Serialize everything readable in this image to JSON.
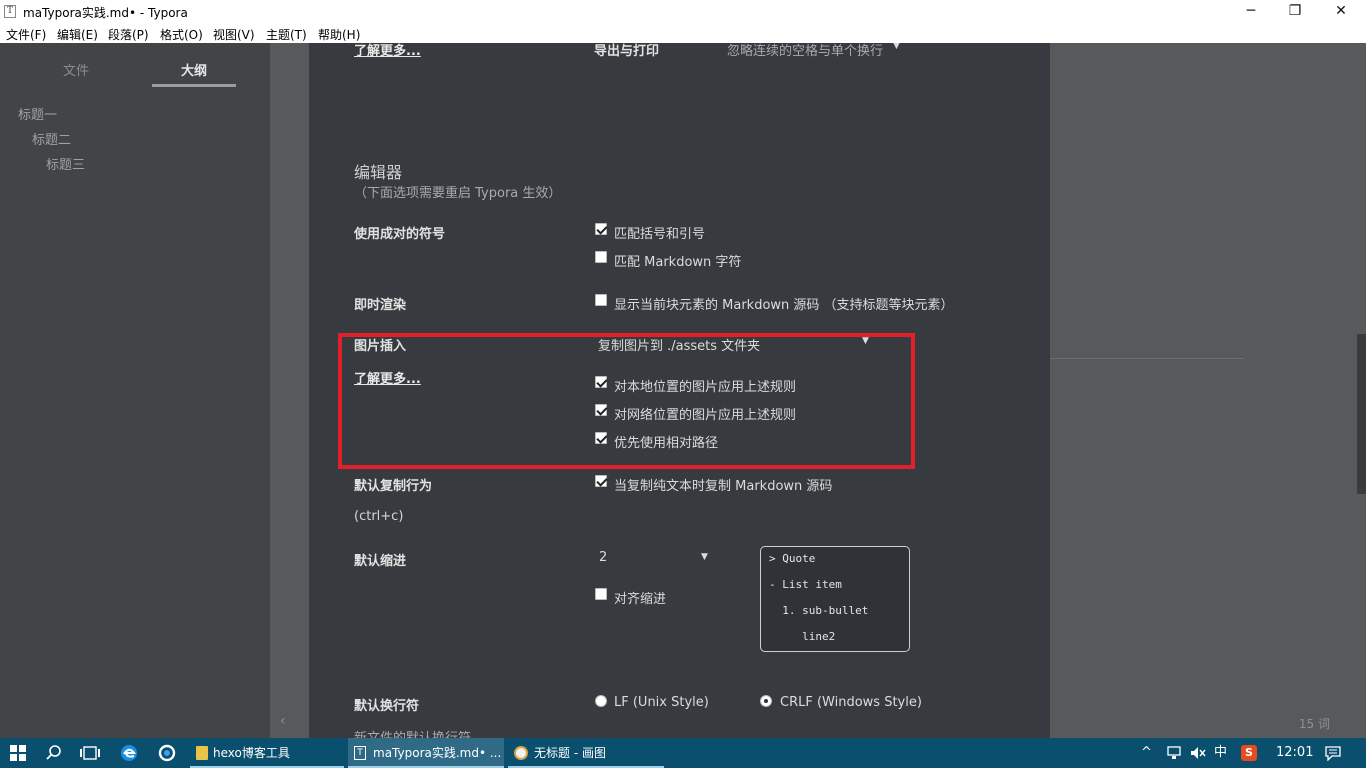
{
  "window": {
    "title": "maTypora实践.md• - Typora",
    "app_icon": "T",
    "minimize_icon": "─",
    "maximize_icon": "❐",
    "close_icon": "✕"
  },
  "menu": [
    "文件(F)",
    "编辑(E)",
    "段落(P)",
    "格式(O)",
    "视图(V)",
    "主题(T)",
    "帮助(H)"
  ],
  "sidebar": {
    "tabs": [
      "文件",
      "大纲"
    ],
    "active_tab": "大纲",
    "outline": [
      "标题一",
      "标题二",
      "标题三"
    ]
  },
  "prefs": {
    "top_link": "了解更多...",
    "export_label": "导出与打印",
    "export_value": "忽略连续的空格与单个换行",
    "editor_title": "编辑器",
    "editor_note": "（下面选项需要重启 Typora 生效）",
    "pairs_label": "使用成对的符号",
    "pairs_opt1": "匹配括号和引号",
    "pairs_opt2": "匹配 Markdown 字符",
    "render_label": "即时渲染",
    "render_opt": "显示当前块元素的 Markdown 源码 （支持标题等块元素）",
    "image_label": "图片插入",
    "image_link": "了解更多...",
    "image_value": "复制图片到 ./assets 文件夹",
    "image_opt1": "对本地位置的图片应用上述规则",
    "image_opt2": "对网络位置的图片应用上述规则",
    "image_opt3": "优先使用相对路径",
    "copy_label": "默认复制行为",
    "copy_shortcut": "(ctrl+c)",
    "copy_opt": "当复制纯文本时复制 Markdown 源码",
    "indent_label": "默认缩进",
    "indent_value": "2",
    "indent_opt": "对齐缩进",
    "preview_lines": [
      "> Quote",
      "- List item",
      "  1. sub-bullet",
      "     line2"
    ],
    "newline_label": "默认换行符",
    "newline_opt1": "LF (Unix Style)",
    "newline_opt2": "CRLF (Windows Style)",
    "newline_sub": "新文件的默认换行符"
  },
  "status": {
    "word_count": "15 词",
    "collapse_icon": "‹"
  },
  "taskbar": {
    "apps": [
      "hexo博客工具",
      "maTypora实践.md• ...",
      "无标题 - 画图"
    ],
    "ime": "中",
    "time": "12:01"
  },
  "colors": {
    "highlight_border": "#e0202b",
    "panel_bg": "#373a3e",
    "sidebar_bg": "#424447",
    "taskbar_bg": "#0b4f6e"
  }
}
